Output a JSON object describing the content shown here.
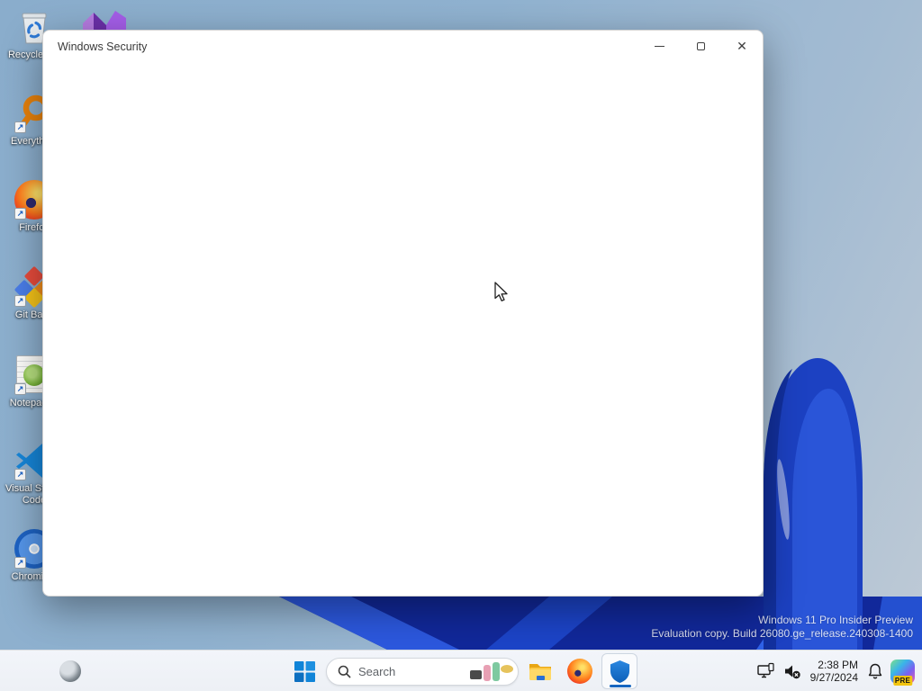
{
  "window": {
    "title": "Windows Security"
  },
  "desktop": {
    "icons": [
      {
        "label": "Recycle Bin"
      },
      {
        "label": "Everything"
      },
      {
        "label": "Firefox"
      },
      {
        "label": "Git Bash"
      },
      {
        "label": "Notepad++"
      },
      {
        "label": "Visual Studio Code"
      },
      {
        "label": "Chromium"
      }
    ]
  },
  "watermark": {
    "line1": "Windows 11 Pro Insider Preview",
    "line2": "Evaluation copy. Build 26080.ge_release.240308-1400"
  },
  "taskbar": {
    "search": {
      "placeholder": "Search"
    },
    "clock": {
      "time": "2:38 PM",
      "date": "9/27/2024"
    },
    "copilot_badge": "PRE"
  },
  "colors": {
    "accent_blue": "#1565c0",
    "bloom_dark": "#11289a",
    "bloom_bright": "#2c58de",
    "taskbar_bg": "#f0f3f8"
  }
}
